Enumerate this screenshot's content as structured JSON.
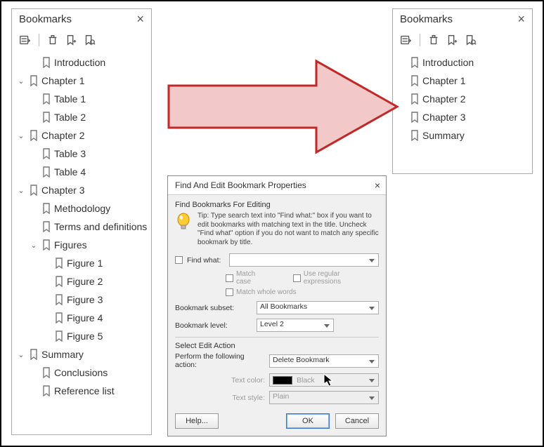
{
  "left_panel": {
    "title": "Bookmarks",
    "items": [
      {
        "level": 1,
        "expand": "none",
        "label": "Introduction"
      },
      {
        "level": 0,
        "expand": "open",
        "label": "Chapter 1"
      },
      {
        "level": 1,
        "expand": "none",
        "label": "Table 1"
      },
      {
        "level": 1,
        "expand": "none",
        "label": "Table 2"
      },
      {
        "level": 0,
        "expand": "open",
        "label": "Chapter 2"
      },
      {
        "level": 1,
        "expand": "none",
        "label": "Table 3"
      },
      {
        "level": 1,
        "expand": "none",
        "label": "Table 4"
      },
      {
        "level": 0,
        "expand": "open",
        "label": "Chapter 3"
      },
      {
        "level": 1,
        "expand": "none",
        "label": "Methodology"
      },
      {
        "level": 1,
        "expand": "none",
        "label": "Terms and definitions"
      },
      {
        "level": 1,
        "expand": "open",
        "label": "Figures"
      },
      {
        "level": 2,
        "expand": "none",
        "label": "Figure 1"
      },
      {
        "level": 2,
        "expand": "none",
        "label": "Figure 2"
      },
      {
        "level": 2,
        "expand": "none",
        "label": "Figure 3"
      },
      {
        "level": 2,
        "expand": "none",
        "label": "Figure 4"
      },
      {
        "level": 2,
        "expand": "none",
        "label": "Figure 5"
      },
      {
        "level": 0,
        "expand": "open",
        "label": "Summary"
      },
      {
        "level": 1,
        "expand": "none",
        "label": "Conclusions"
      },
      {
        "level": 1,
        "expand": "none",
        "label": "Reference list"
      }
    ]
  },
  "right_panel": {
    "title": "Bookmarks",
    "items": [
      {
        "level": 0,
        "expand": "none",
        "label": "Introduction"
      },
      {
        "level": 0,
        "expand": "none",
        "label": "Chapter 1"
      },
      {
        "level": 0,
        "expand": "none",
        "label": "Chapter 2"
      },
      {
        "level": 0,
        "expand": "none",
        "label": "Chapter 3"
      },
      {
        "level": 0,
        "expand": "none",
        "label": "Summary"
      }
    ]
  },
  "dialog": {
    "title": "Find And Edit Bookmark Properties",
    "group1": "Find Bookmarks For Editing",
    "tip": "Tip: Type search text into \"Find what:\" box if you want to edit bookmarks with matching text in the title. Uncheck \"Find what\" option if you do not want to match any specific bookmark by title.",
    "find_what_label": "Find what:",
    "match_case": "Match case",
    "match_whole": "Match whole words",
    "use_regex": "Use regular expressions",
    "subset_label": "Bookmark subset:",
    "subset_value": "All Bookmarks",
    "level_label": "Bookmark level:",
    "level_value": "Level 2",
    "group2": "Select Edit Action",
    "action_label": "Perform the following action:",
    "action_value": "Delete Bookmark",
    "textcolor_label": "Text color:",
    "textcolor_value": "Black",
    "textstyle_label": "Text style:",
    "textstyle_value": "Plain",
    "help": "Help...",
    "ok": "OK",
    "cancel": "Cancel"
  }
}
